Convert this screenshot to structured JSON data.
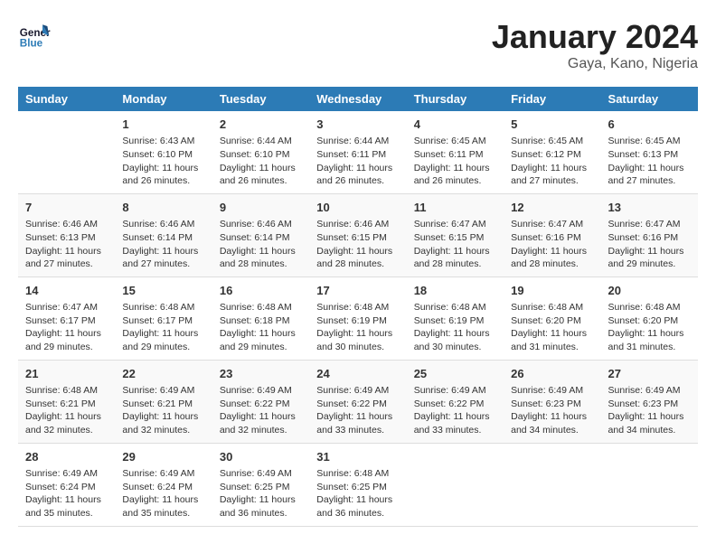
{
  "logo": {
    "line1": "General",
    "line2": "Blue"
  },
  "title": "January 2024",
  "location": "Gaya, Kano, Nigeria",
  "days_of_week": [
    "Sunday",
    "Monday",
    "Tuesday",
    "Wednesday",
    "Thursday",
    "Friday",
    "Saturday"
  ],
  "weeks": [
    [
      {
        "day": "",
        "sunrise": "",
        "sunset": "",
        "daylight": ""
      },
      {
        "day": "1",
        "sunrise": "Sunrise: 6:43 AM",
        "sunset": "Sunset: 6:10 PM",
        "daylight": "Daylight: 11 hours and 26 minutes."
      },
      {
        "day": "2",
        "sunrise": "Sunrise: 6:44 AM",
        "sunset": "Sunset: 6:10 PM",
        "daylight": "Daylight: 11 hours and 26 minutes."
      },
      {
        "day": "3",
        "sunrise": "Sunrise: 6:44 AM",
        "sunset": "Sunset: 6:11 PM",
        "daylight": "Daylight: 11 hours and 26 minutes."
      },
      {
        "day": "4",
        "sunrise": "Sunrise: 6:45 AM",
        "sunset": "Sunset: 6:11 PM",
        "daylight": "Daylight: 11 hours and 26 minutes."
      },
      {
        "day": "5",
        "sunrise": "Sunrise: 6:45 AM",
        "sunset": "Sunset: 6:12 PM",
        "daylight": "Daylight: 11 hours and 27 minutes."
      },
      {
        "day": "6",
        "sunrise": "Sunrise: 6:45 AM",
        "sunset": "Sunset: 6:13 PM",
        "daylight": "Daylight: 11 hours and 27 minutes."
      }
    ],
    [
      {
        "day": "7",
        "sunrise": "Sunrise: 6:46 AM",
        "sunset": "Sunset: 6:13 PM",
        "daylight": "Daylight: 11 hours and 27 minutes."
      },
      {
        "day": "8",
        "sunrise": "Sunrise: 6:46 AM",
        "sunset": "Sunset: 6:14 PM",
        "daylight": "Daylight: 11 hours and 27 minutes."
      },
      {
        "day": "9",
        "sunrise": "Sunrise: 6:46 AM",
        "sunset": "Sunset: 6:14 PM",
        "daylight": "Daylight: 11 hours and 28 minutes."
      },
      {
        "day": "10",
        "sunrise": "Sunrise: 6:46 AM",
        "sunset": "Sunset: 6:15 PM",
        "daylight": "Daylight: 11 hours and 28 minutes."
      },
      {
        "day": "11",
        "sunrise": "Sunrise: 6:47 AM",
        "sunset": "Sunset: 6:15 PM",
        "daylight": "Daylight: 11 hours and 28 minutes."
      },
      {
        "day": "12",
        "sunrise": "Sunrise: 6:47 AM",
        "sunset": "Sunset: 6:16 PM",
        "daylight": "Daylight: 11 hours and 28 minutes."
      },
      {
        "day": "13",
        "sunrise": "Sunrise: 6:47 AM",
        "sunset": "Sunset: 6:16 PM",
        "daylight": "Daylight: 11 hours and 29 minutes."
      }
    ],
    [
      {
        "day": "14",
        "sunrise": "Sunrise: 6:47 AM",
        "sunset": "Sunset: 6:17 PM",
        "daylight": "Daylight: 11 hours and 29 minutes."
      },
      {
        "day": "15",
        "sunrise": "Sunrise: 6:48 AM",
        "sunset": "Sunset: 6:17 PM",
        "daylight": "Daylight: 11 hours and 29 minutes."
      },
      {
        "day": "16",
        "sunrise": "Sunrise: 6:48 AM",
        "sunset": "Sunset: 6:18 PM",
        "daylight": "Daylight: 11 hours and 29 minutes."
      },
      {
        "day": "17",
        "sunrise": "Sunrise: 6:48 AM",
        "sunset": "Sunset: 6:19 PM",
        "daylight": "Daylight: 11 hours and 30 minutes."
      },
      {
        "day": "18",
        "sunrise": "Sunrise: 6:48 AM",
        "sunset": "Sunset: 6:19 PM",
        "daylight": "Daylight: 11 hours and 30 minutes."
      },
      {
        "day": "19",
        "sunrise": "Sunrise: 6:48 AM",
        "sunset": "Sunset: 6:20 PM",
        "daylight": "Daylight: 11 hours and 31 minutes."
      },
      {
        "day": "20",
        "sunrise": "Sunrise: 6:48 AM",
        "sunset": "Sunset: 6:20 PM",
        "daylight": "Daylight: 11 hours and 31 minutes."
      }
    ],
    [
      {
        "day": "21",
        "sunrise": "Sunrise: 6:48 AM",
        "sunset": "Sunset: 6:21 PM",
        "daylight": "Daylight: 11 hours and 32 minutes."
      },
      {
        "day": "22",
        "sunrise": "Sunrise: 6:49 AM",
        "sunset": "Sunset: 6:21 PM",
        "daylight": "Daylight: 11 hours and 32 minutes."
      },
      {
        "day": "23",
        "sunrise": "Sunrise: 6:49 AM",
        "sunset": "Sunset: 6:22 PM",
        "daylight": "Daylight: 11 hours and 32 minutes."
      },
      {
        "day": "24",
        "sunrise": "Sunrise: 6:49 AM",
        "sunset": "Sunset: 6:22 PM",
        "daylight": "Daylight: 11 hours and 33 minutes."
      },
      {
        "day": "25",
        "sunrise": "Sunrise: 6:49 AM",
        "sunset": "Sunset: 6:22 PM",
        "daylight": "Daylight: 11 hours and 33 minutes."
      },
      {
        "day": "26",
        "sunrise": "Sunrise: 6:49 AM",
        "sunset": "Sunset: 6:23 PM",
        "daylight": "Daylight: 11 hours and 34 minutes."
      },
      {
        "day": "27",
        "sunrise": "Sunrise: 6:49 AM",
        "sunset": "Sunset: 6:23 PM",
        "daylight": "Daylight: 11 hours and 34 minutes."
      }
    ],
    [
      {
        "day": "28",
        "sunrise": "Sunrise: 6:49 AM",
        "sunset": "Sunset: 6:24 PM",
        "daylight": "Daylight: 11 hours and 35 minutes."
      },
      {
        "day": "29",
        "sunrise": "Sunrise: 6:49 AM",
        "sunset": "Sunset: 6:24 PM",
        "daylight": "Daylight: 11 hours and 35 minutes."
      },
      {
        "day": "30",
        "sunrise": "Sunrise: 6:49 AM",
        "sunset": "Sunset: 6:25 PM",
        "daylight": "Daylight: 11 hours and 36 minutes."
      },
      {
        "day": "31",
        "sunrise": "Sunrise: 6:48 AM",
        "sunset": "Sunset: 6:25 PM",
        "daylight": "Daylight: 11 hours and 36 minutes."
      },
      {
        "day": "",
        "sunrise": "",
        "sunset": "",
        "daylight": ""
      },
      {
        "day": "",
        "sunrise": "",
        "sunset": "",
        "daylight": ""
      },
      {
        "day": "",
        "sunrise": "",
        "sunset": "",
        "daylight": ""
      }
    ]
  ]
}
